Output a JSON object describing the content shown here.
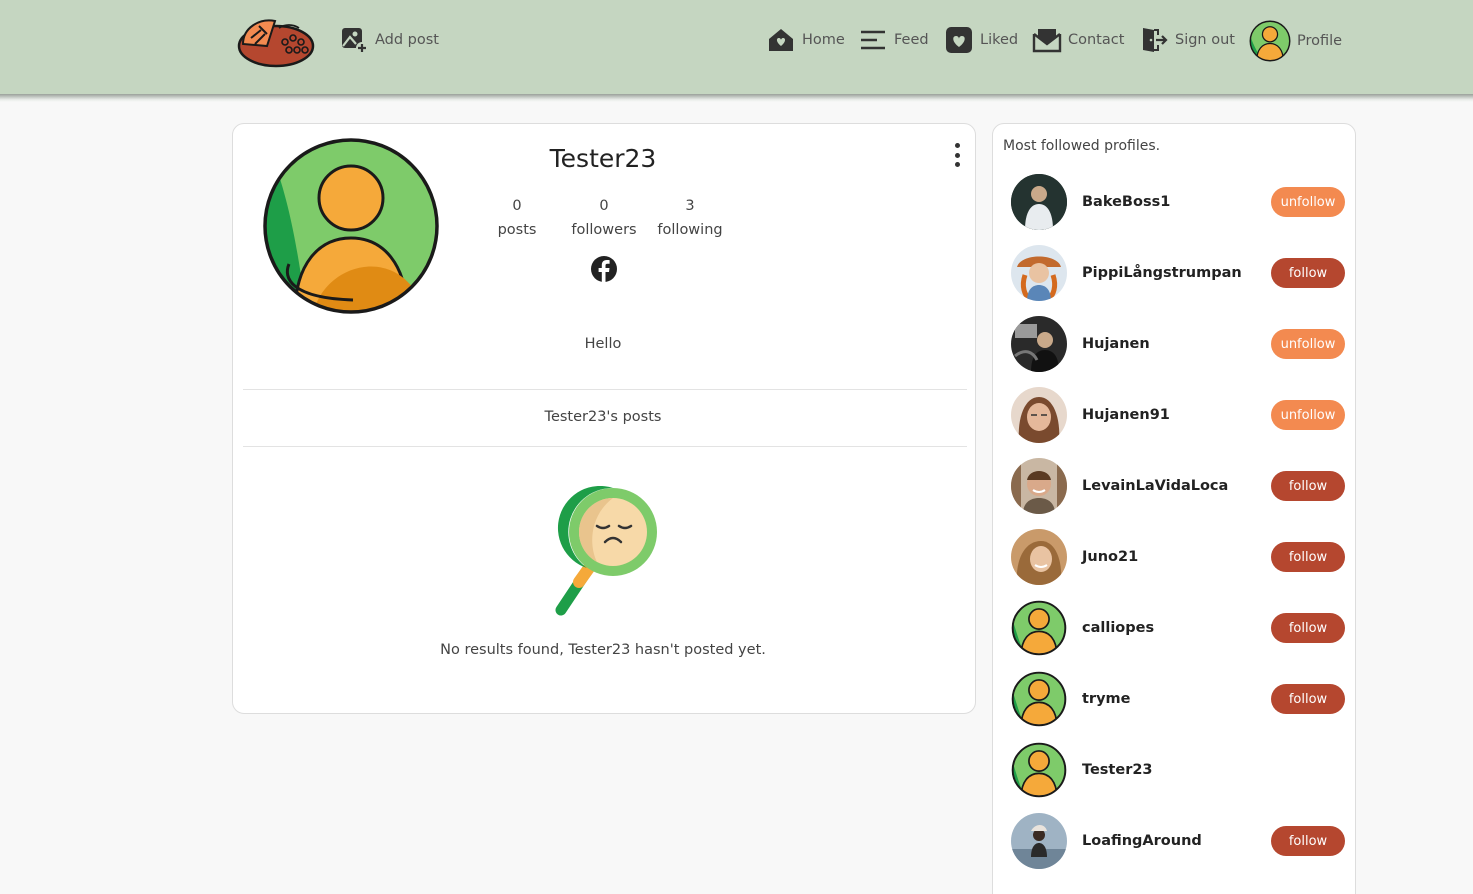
{
  "nav": {
    "add_post": "Add post",
    "home": "Home",
    "feed": "Feed",
    "liked": "Liked",
    "contact": "Contact",
    "sign_out": "Sign out",
    "profile": "Profile"
  },
  "profile": {
    "username": "Tester23",
    "posts_count": "0",
    "posts_label": "posts",
    "followers_count": "0",
    "followers_label": "followers",
    "following_count": "3",
    "following_label": "following",
    "bio": "Hello",
    "posts_heading": "Tester23's posts",
    "no_results": "No results found, Tester23 hasn't posted yet."
  },
  "sidebar": {
    "title": "Most followed profiles.",
    "profiles": [
      {
        "name": "BakeBoss1",
        "button": "unfollow",
        "avatar": "photo"
      },
      {
        "name": "PippiLångstrumpan",
        "button": "follow",
        "avatar": "photo"
      },
      {
        "name": "Hujanen",
        "button": "unfollow",
        "avatar": "photo"
      },
      {
        "name": "Hujanen91",
        "button": "unfollow",
        "avatar": "photo"
      },
      {
        "name": "LevainLaVidaLoca",
        "button": "follow",
        "avatar": "photo"
      },
      {
        "name": "Juno21",
        "button": "follow",
        "avatar": "photo"
      },
      {
        "name": "calliopes",
        "button": "follow",
        "avatar": "default"
      },
      {
        "name": "tryme",
        "button": "follow",
        "avatar": "default"
      },
      {
        "name": "Tester23",
        "button": "",
        "avatar": "default"
      },
      {
        "name": "LoafingAround",
        "button": "follow",
        "avatar": "photo"
      }
    ]
  },
  "colors": {
    "navbar": "#c5d6c1",
    "follow": "#b5472f",
    "unfollow": "#f38a50",
    "avatar_green": "#7ecb6a",
    "avatar_orange": "#f5a93a"
  }
}
